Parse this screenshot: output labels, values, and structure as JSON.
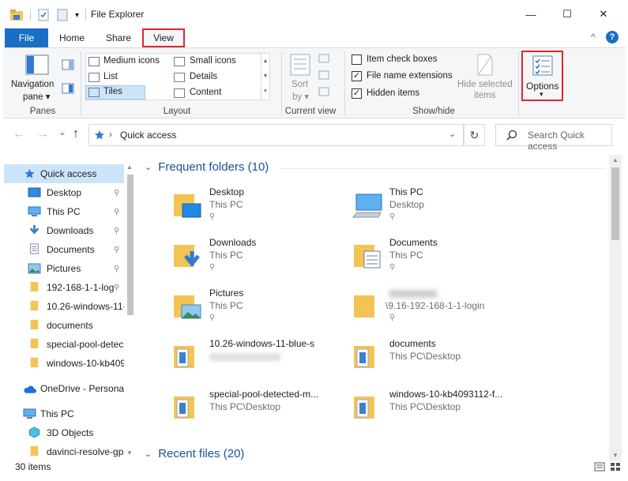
{
  "window": {
    "title": "File Explorer",
    "minimize": "—",
    "maximize": "☐",
    "close": "✕"
  },
  "tabs": {
    "file": "File",
    "home": "Home",
    "share": "Share",
    "view": "View",
    "collapse": "^",
    "help": "?"
  },
  "ribbon": {
    "panes": {
      "nav_pane": "Navigation",
      "nav_pane2": "pane ▾",
      "label": "Panes"
    },
    "layout": {
      "medium_icons": "Medium icons",
      "small_icons": "Small icons",
      "list": "List",
      "details": "Details",
      "tiles": "Tiles",
      "content": "Content",
      "label": "Layout"
    },
    "current_view": {
      "sort": "Sort",
      "sort_by": "by ▾",
      "label": "Current view"
    },
    "show_hide": {
      "item_check_boxes": "Item check boxes",
      "item_check_boxes_checked": false,
      "file_name_extensions": "File name extensions",
      "file_name_extensions_checked": true,
      "hidden_items": "Hidden items",
      "hidden_items_checked": true,
      "hide_selected": "Hide selected",
      "hide_selected2": "items",
      "label": "Show/hide"
    },
    "options": {
      "label": "Options",
      "arrow": "▾"
    }
  },
  "navbar": {
    "back": "←",
    "forward": "→",
    "dropdown": "⌄",
    "up": "↑",
    "location": "Quick access",
    "chevron": "›",
    "refresh": "↻",
    "search_placeholder": "Search Quick access"
  },
  "sidebar": {
    "items": [
      {
        "label": "Quick access",
        "icon": "star-icon",
        "pinned": false
      },
      {
        "label": "Desktop",
        "icon": "desktop-icon",
        "pinned": true
      },
      {
        "label": "This PC",
        "icon": "computer-icon",
        "pinned": true
      },
      {
        "label": "Downloads",
        "icon": "download-icon",
        "pinned": true
      },
      {
        "label": "Documents",
        "icon": "documents-icon",
        "pinned": true
      },
      {
        "label": "Pictures",
        "icon": "pictures-icon",
        "pinned": true
      },
      {
        "label": "192-168-1-1-log",
        "icon": "folder-icon",
        "pinned": true
      },
      {
        "label": "10.26-windows-11-",
        "icon": "folder-icon",
        "pinned": false
      },
      {
        "label": "documents",
        "icon": "folder-icon",
        "pinned": false
      },
      {
        "label": "special-pool-detect",
        "icon": "folder-icon",
        "pinned": false
      },
      {
        "label": "windows-10-kb409",
        "icon": "folder-icon",
        "pinned": false
      },
      {
        "label": "OneDrive - Personal",
        "icon": "onedrive-icon",
        "pinned": false
      },
      {
        "label": "This PC",
        "icon": "computer-icon",
        "pinned": false
      },
      {
        "label": "3D Objects",
        "icon": "3d-objects-icon",
        "pinned": false
      },
      {
        "label": "davinci-resolve-gp",
        "icon": "folder-icon",
        "pinned": false
      }
    ],
    "pin_glyph": "⚲"
  },
  "content": {
    "frequent_header": "Frequent folders (10)",
    "recent_header": "Recent files (20)",
    "tiles": [
      {
        "name": "Desktop",
        "sub": "This PC",
        "pinned": true,
        "icon": "desktop-folder-icon"
      },
      {
        "name": "This PC",
        "sub": "Desktop",
        "pinned": true,
        "icon": "computer-icon"
      },
      {
        "name": "Downloads",
        "sub": "This PC",
        "pinned": true,
        "icon": "downloads-folder-icon"
      },
      {
        "name": "Documents",
        "sub": "This PC",
        "pinned": true,
        "icon": "documents-folder-icon"
      },
      {
        "name": "Pictures",
        "sub": "This PC",
        "pinned": true,
        "icon": "pictures-folder-icon"
      },
      {
        "name": "",
        "sub": "\\9.16-192-168-1-1-login",
        "pinned": true,
        "icon": "folder-icon"
      },
      {
        "name": "10.26-windows-11-blue-s",
        "sub": "",
        "pinned": false,
        "icon": "folder-icon"
      },
      {
        "name": "documents",
        "sub": "This PC\\Desktop",
        "pinned": false,
        "icon": "folder-icon"
      },
      {
        "name": "special-pool-detected-m...",
        "sub": "This PC\\Desktop",
        "pinned": false,
        "icon": "folder-icon"
      },
      {
        "name": "windows-10-kb4093112-f...",
        "sub": "This PC\\Desktop",
        "pinned": false,
        "icon": "folder-icon"
      }
    ]
  },
  "status": {
    "items": "30 items"
  },
  "colors": {
    "accent": "#1a6fc4",
    "highlight_border": "#e3262f",
    "folder": "#f3c454",
    "header_blue": "#1b4f9c"
  }
}
